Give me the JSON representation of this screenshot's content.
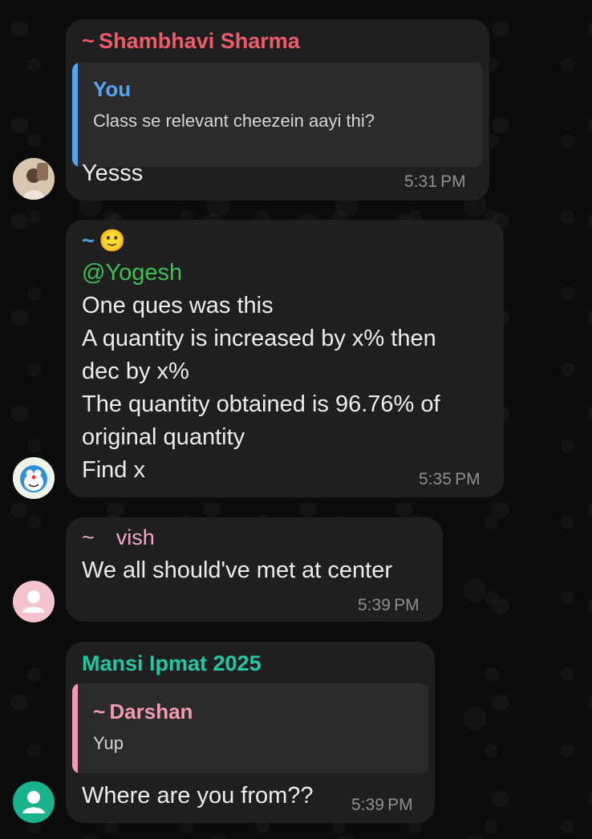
{
  "colors": {
    "background": "#0b0b0b",
    "bubble": "#1f1f1f",
    "quote_bg": "#2b2b2b",
    "shambhavi": "#ef5b6a",
    "you_quote": "#53a4f2",
    "yogesh_mention": "#3fbf56",
    "vish": "#f4a6c4",
    "mansi": "#22c7a3",
    "darshan": "#f29ab5"
  },
  "messages": [
    {
      "sender": "~ Shambhavi Sharma",
      "quote": {
        "name": "You",
        "text": "Class se relevant cheezein aayi thi?"
      },
      "text": "Yesss",
      "time": "5:31 PM",
      "avatar_icon": "profile-photo-icon"
    },
    {
      "sender": "~ 🙂",
      "lines": [
        "@Yogesh",
        "One ques was this",
        "A quantity is increased by x% then",
        "dec by x%",
        "The quantity obtained is 96.76% of",
        "original quantity",
        "Find x"
      ],
      "time": "5:35 PM",
      "avatar_icon": "doraemon-avatar-icon"
    },
    {
      "sender": "~ vish",
      "text": "We all should've met at center",
      "time": "5:39 PM",
      "avatar_icon": "default-user-icon"
    },
    {
      "sender": "Mansi Ipmat 2025",
      "quote": {
        "name": "~ Darshan",
        "text": "Yup"
      },
      "text": "Where are you from??",
      "time": "5:39 PM",
      "avatar_icon": "default-user-icon"
    }
  ]
}
